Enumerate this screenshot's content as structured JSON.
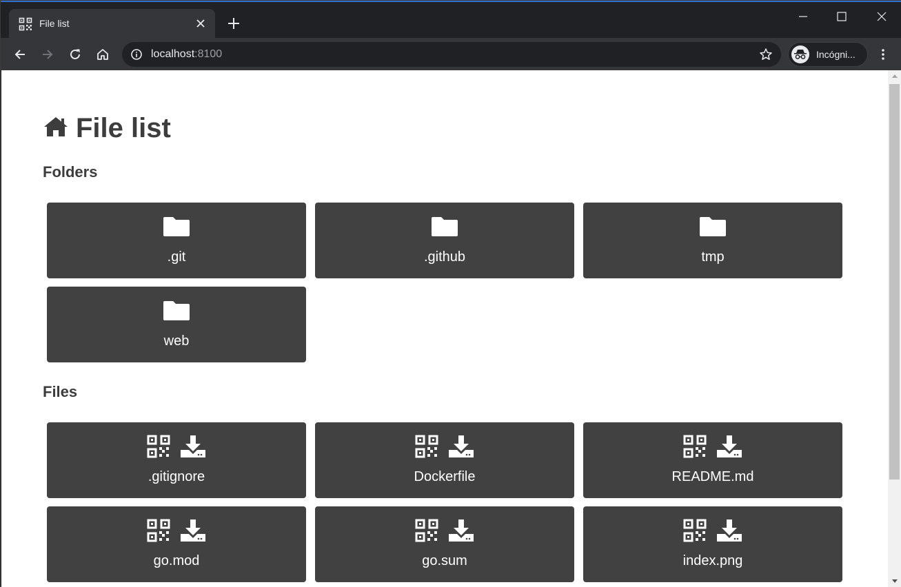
{
  "browser": {
    "tab_title": "File list",
    "url_host": "localhost",
    "url_port": ":8100",
    "profile_label": "Incógni..."
  },
  "page": {
    "title": "File list",
    "folders_heading": "Folders",
    "files_heading": "Files",
    "folders": [
      {
        "name": ".git"
      },
      {
        "name": ".github"
      },
      {
        "name": "tmp"
      },
      {
        "name": "web"
      }
    ],
    "files": [
      {
        "name": ".gitignore"
      },
      {
        "name": "Dockerfile"
      },
      {
        "name": "README.md"
      },
      {
        "name": "go.mod"
      },
      {
        "name": "go.sum"
      },
      {
        "name": "index.png"
      }
    ]
  },
  "colors": {
    "card_bg": "#414141",
    "heading": "#3d3d3d",
    "browser_frame": "#202124",
    "toolbar": "#35363a"
  },
  "icons": {
    "folder": "folder-icon",
    "qr": "qr-code-icon",
    "download": "download-icon",
    "home": "home-icon"
  }
}
